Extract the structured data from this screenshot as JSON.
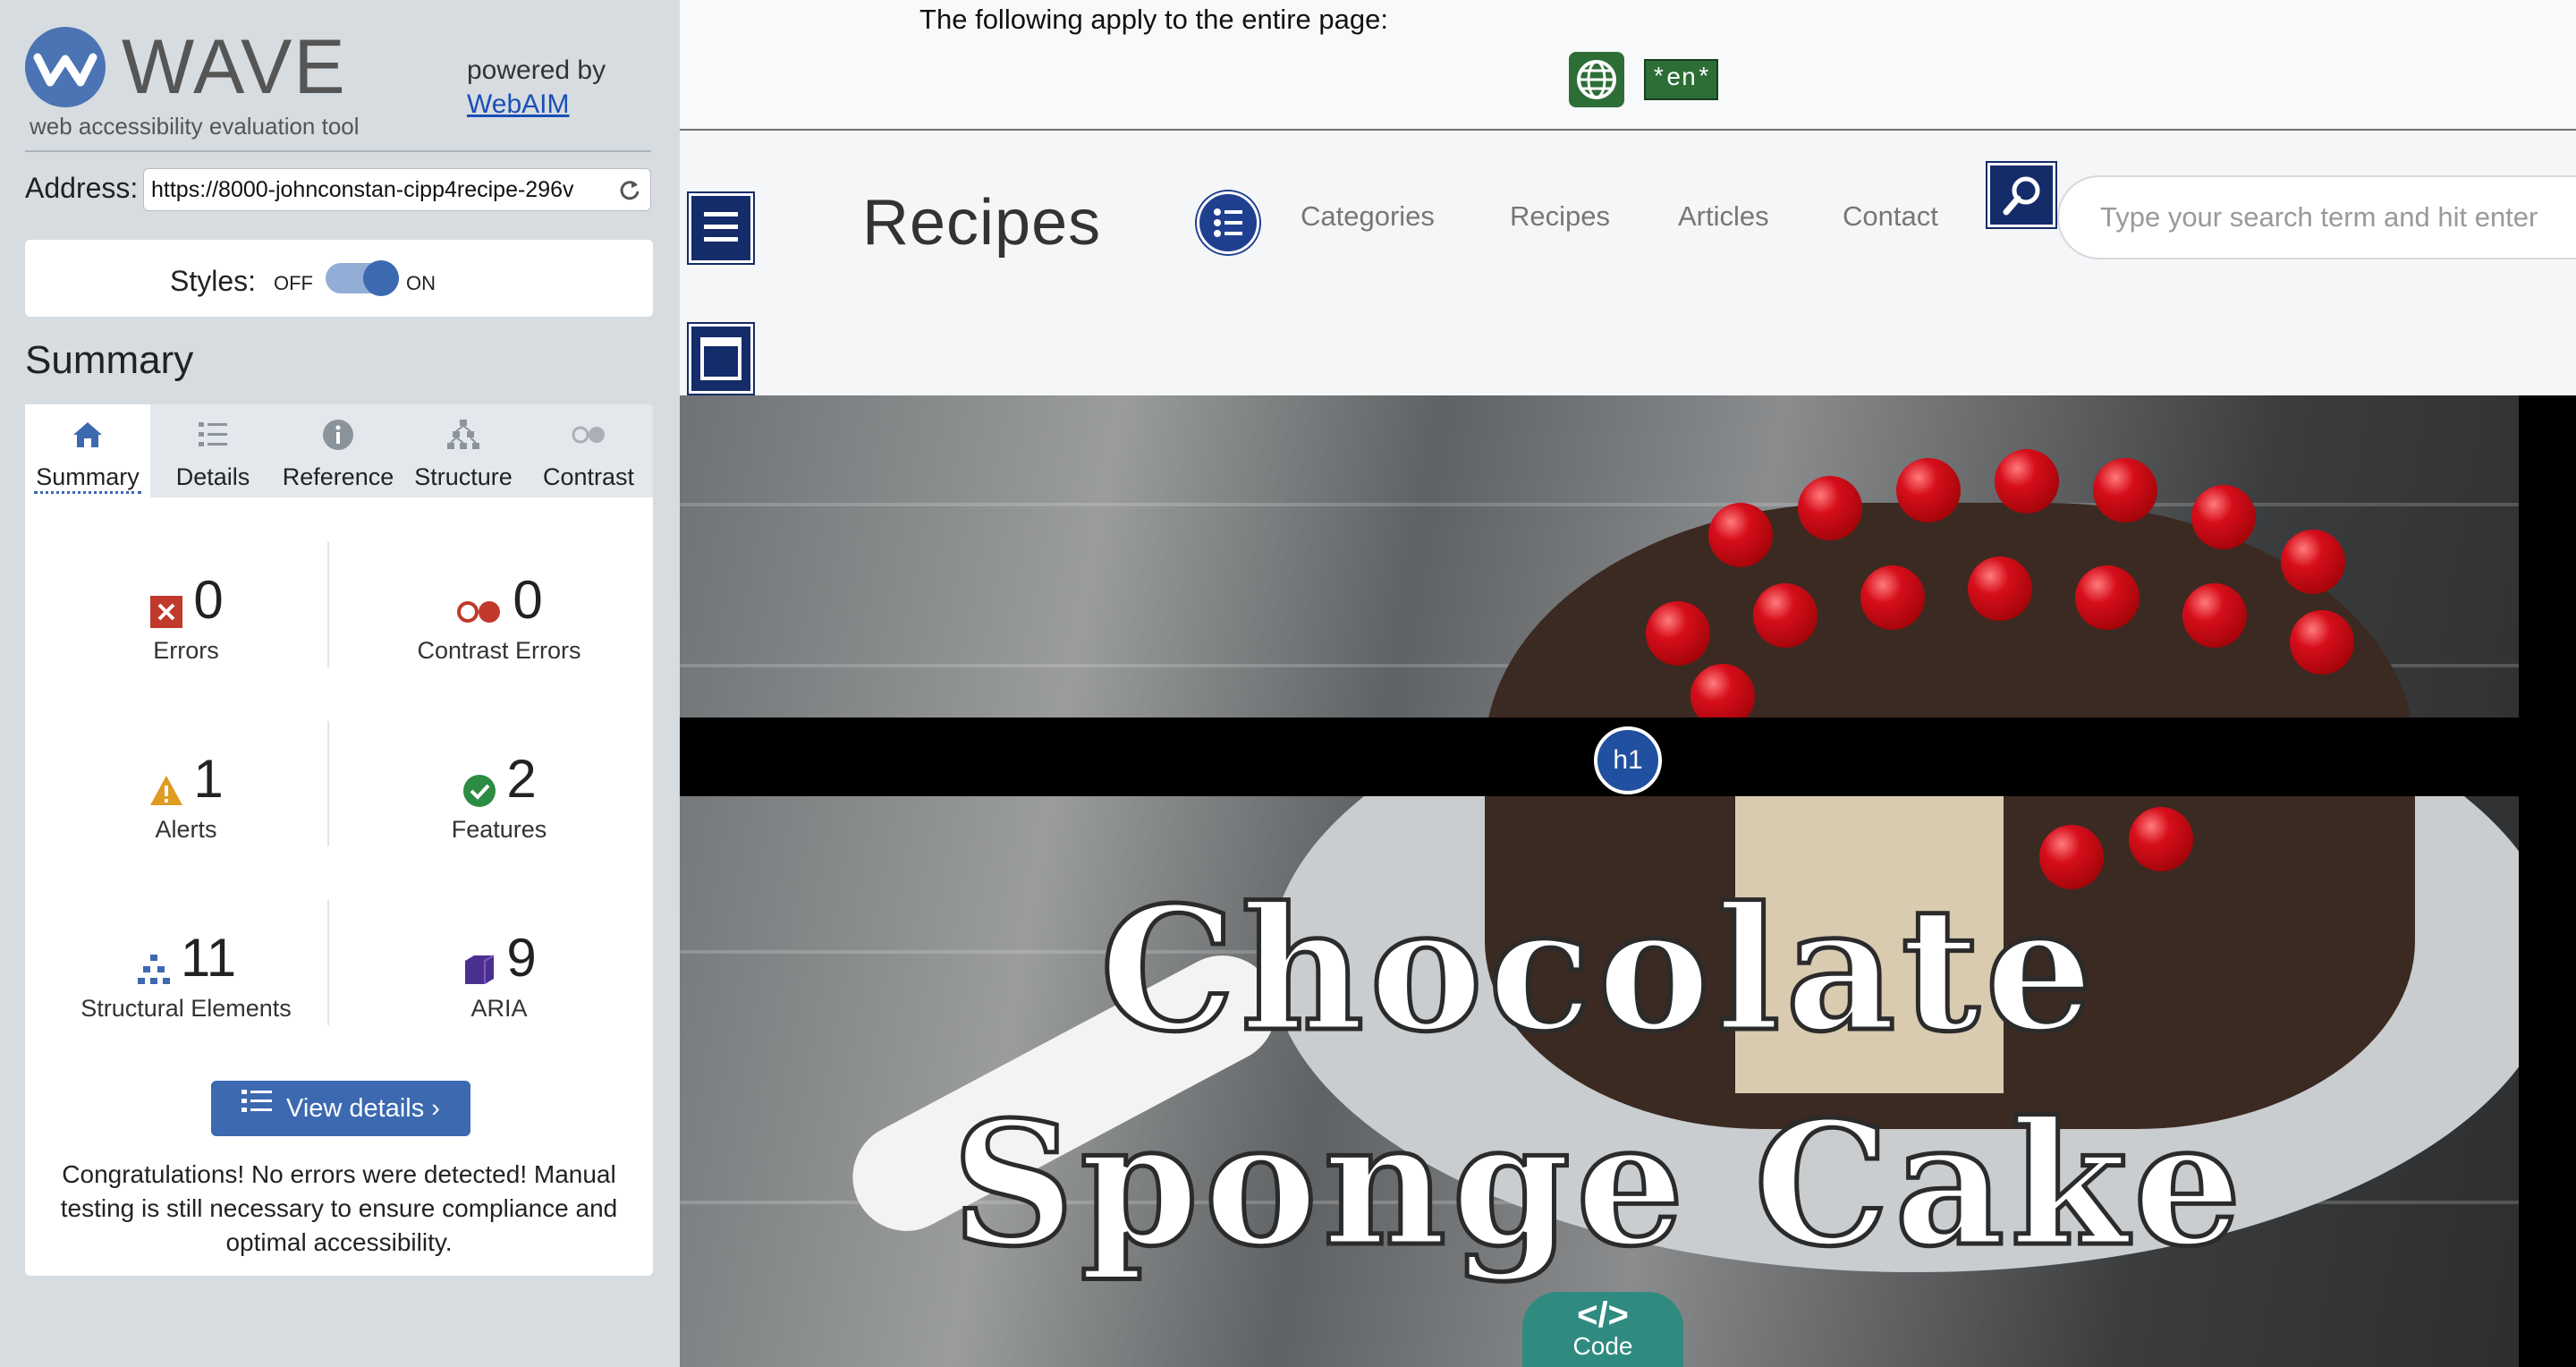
{
  "wave": {
    "brand": "WAVE",
    "tagline": "web accessibility evaluation tool",
    "powered_by": "powered by",
    "webaim_link": "WebAIM",
    "address_label": "Address:",
    "address_value": "https://8000-johnconstan-cipp4recipe-296v",
    "styles_label": "Styles:",
    "styles_off": "OFF",
    "styles_on": "ON",
    "summary_heading": "Summary",
    "tabs": [
      {
        "label": "Summary",
        "icon": "home-icon"
      },
      {
        "label": "Details",
        "icon": "list-icon"
      },
      {
        "label": "Reference",
        "icon": "info-icon"
      },
      {
        "label": "Structure",
        "icon": "hierarchy-icon"
      },
      {
        "label": "Contrast",
        "icon": "contrast-toggle-icon"
      }
    ],
    "stats": {
      "errors": {
        "count": "0",
        "label": "Errors",
        "icon": "error-x-icon",
        "color": "#c0392b"
      },
      "contrast_errors": {
        "count": "0",
        "label": "Contrast Errors",
        "icon": "contrast-error-icon",
        "color": "#c0392b"
      },
      "alerts": {
        "count": "1",
        "label": "Alerts",
        "icon": "alert-triangle-icon",
        "color": "#e09b22"
      },
      "features": {
        "count": "2",
        "label": "Features",
        "icon": "check-circle-icon",
        "color": "#2e8b43"
      },
      "structural": {
        "count": "11",
        "label": "Structural Elements",
        "icon": "structure-icon",
        "color": "#3c69b0"
      },
      "aria": {
        "count": "9",
        "label": "ARIA",
        "icon": "aria-cube-icon",
        "color": "#4b2f8f"
      }
    },
    "view_details": "View details ›",
    "congrats": "Congratulations! No errors were detected! Manual testing is still necessary to ensure compliance and optimal accessibility."
  },
  "page": {
    "doc_banner": "The following apply to the entire page:",
    "lang_badge": "*en*",
    "site_title": "Recipes",
    "nav": [
      "Categories",
      "Recipes",
      "Articles",
      "Contact"
    ],
    "search_placeholder": "Type your search term and hit enter",
    "hero_title_line1": "Chocolate",
    "hero_title_line2": "Sponge Cake",
    "h1_badge": "h1",
    "code_glyph": "</>",
    "code_label": "Code"
  },
  "colors": {
    "accent": "#3c69b0",
    "aria_box": "#152c6b",
    "feature_green": "#2c6e36",
    "code_teal": "#2f8a7f"
  }
}
